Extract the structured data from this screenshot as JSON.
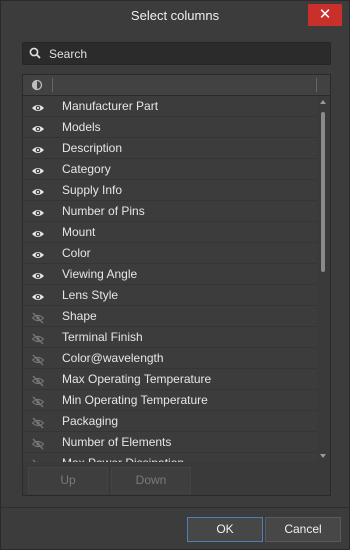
{
  "window": {
    "title": "Select columns",
    "close_label": "✕"
  },
  "search": {
    "placeholder": "Search"
  },
  "columns": [
    {
      "label": "Manufacturer Part",
      "visible": true
    },
    {
      "label": "Models",
      "visible": true
    },
    {
      "label": "Description",
      "visible": true
    },
    {
      "label": "Category",
      "visible": true
    },
    {
      "label": "Supply Info",
      "visible": true
    },
    {
      "label": "Number of Pins",
      "visible": true
    },
    {
      "label": "Mount",
      "visible": true
    },
    {
      "label": "Color",
      "visible": true
    },
    {
      "label": "Viewing Angle",
      "visible": true
    },
    {
      "label": "Lens Style",
      "visible": true
    },
    {
      "label": "Shape",
      "visible": false
    },
    {
      "label": "Terminal Finish",
      "visible": false
    },
    {
      "label": "Color@wavelength",
      "visible": false
    },
    {
      "label": "Max Operating Temperature",
      "visible": false
    },
    {
      "label": "Min Operating Temperature",
      "visible": false
    },
    {
      "label": "Packaging",
      "visible": false
    },
    {
      "label": "Number of Elements",
      "visible": false
    },
    {
      "label": "Max Power Dissipation",
      "visible": false
    },
    {
      "label": "",
      "visible": false
    }
  ],
  "move": {
    "up_label": "Up",
    "down_label": "Down"
  },
  "footer": {
    "ok_label": "OK",
    "cancel_label": "Cancel"
  }
}
